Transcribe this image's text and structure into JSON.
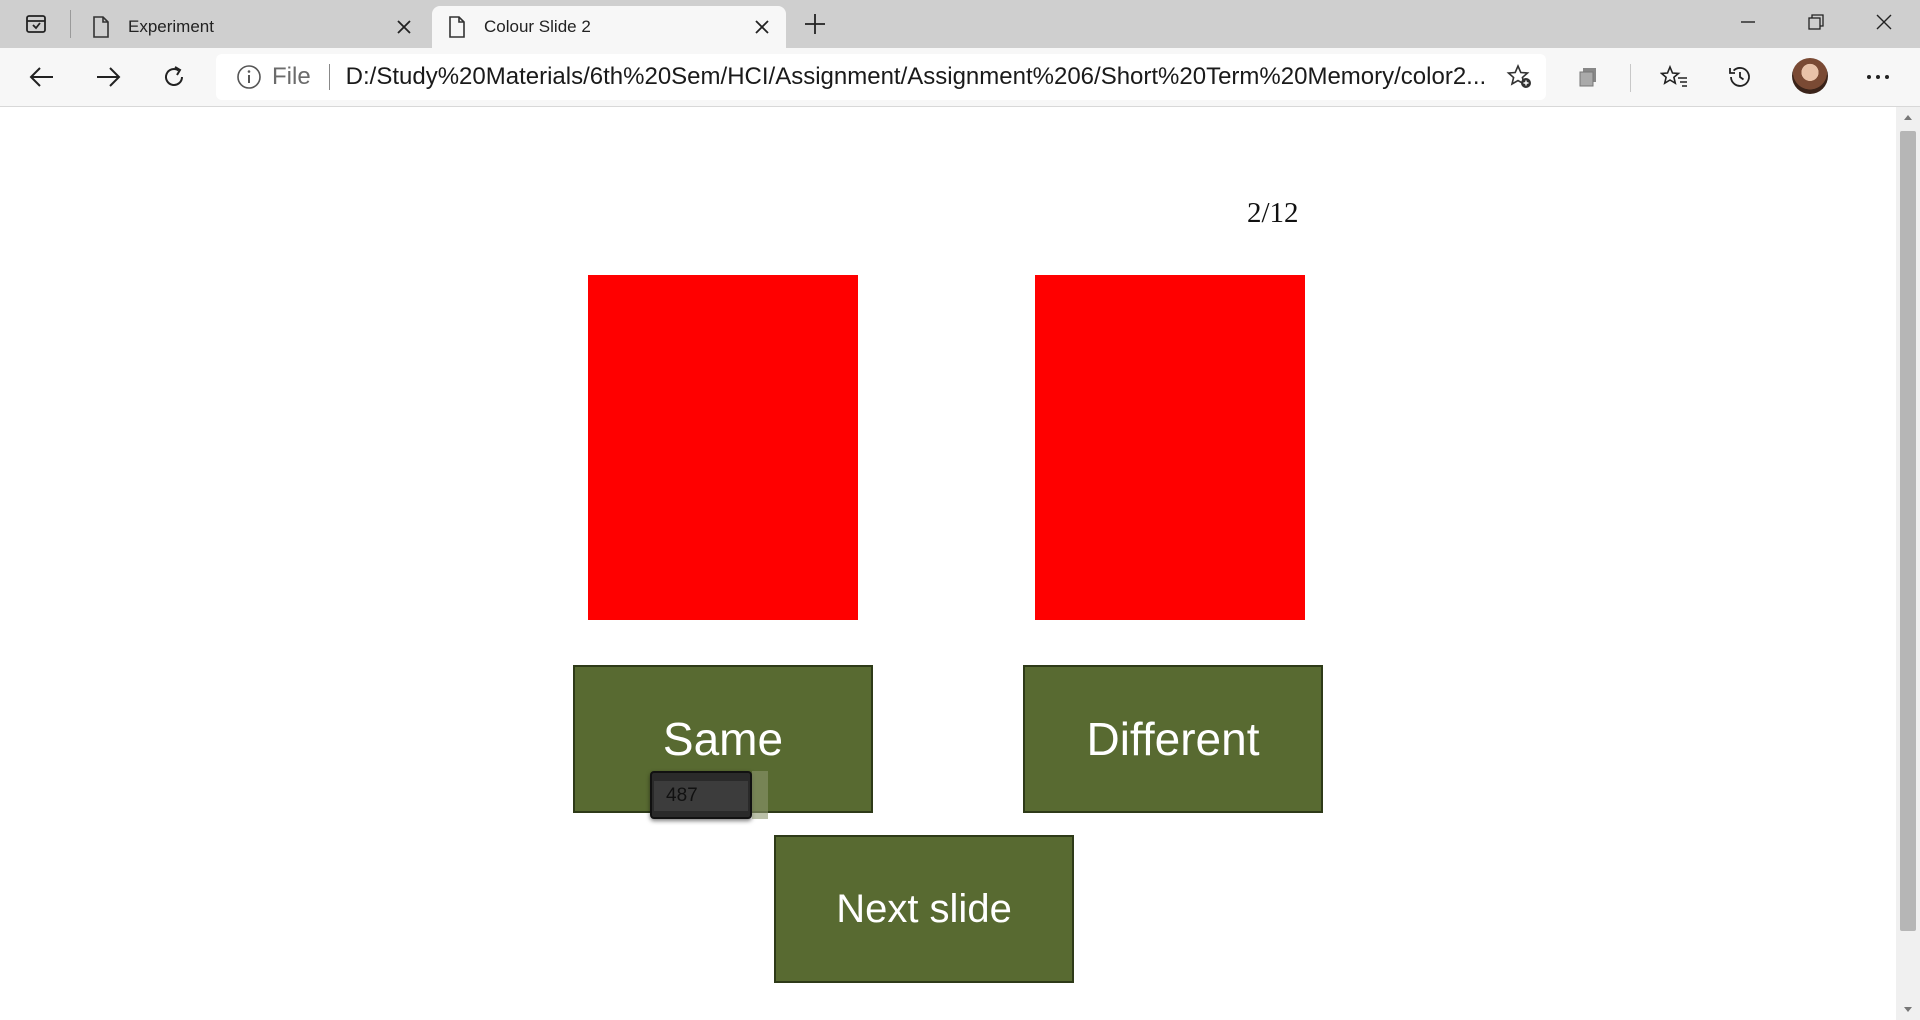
{
  "browser": {
    "tabs": [
      {
        "title": "Experiment",
        "icon": "page-icon",
        "active": false
      },
      {
        "title": "Colour Slide 2",
        "icon": "page-icon",
        "active": true
      }
    ],
    "address": {
      "scheme_label": "File",
      "url": "D:/Study%20Materials/6th%20Sem/HCI/Assignment/Assignment%206/Short%20Term%20Memory/color2..."
    }
  },
  "slide": {
    "counter": "2/12",
    "colors": {
      "left_swatch": "#ff0000",
      "right_swatch": "#ff0000",
      "button_bg": "#586a31",
      "button_text": "#ffffff"
    },
    "buttons": {
      "same": "Same",
      "different": "Different",
      "next": "Next slide"
    },
    "tooltip_value": "487"
  }
}
